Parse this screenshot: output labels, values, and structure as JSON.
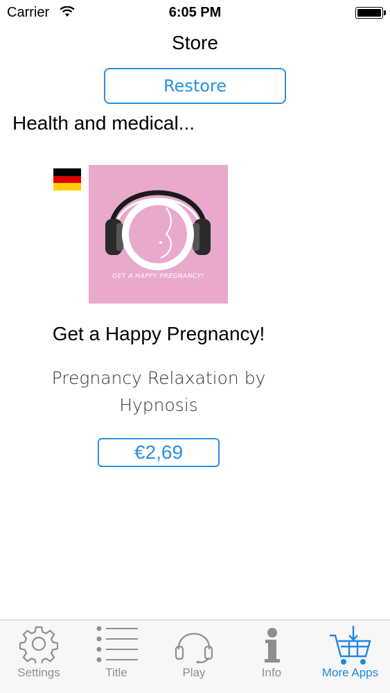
{
  "status_bar": {
    "carrier": "Carrier",
    "time": "6:05 PM",
    "battery_level": 1.0
  },
  "nav": {
    "title": "Store",
    "restore_label": "Restore"
  },
  "section": {
    "title": "Health and medical..."
  },
  "product": {
    "language_flag": "german-flag",
    "artwork_caption": "GET A HAPPY PREGNANCY!",
    "title": "Get a Happy Pregnancy!",
    "subtitle": "Pregnancy Relaxation by Hypnosis",
    "price": "€2,69"
  },
  "tab_bar": {
    "items": [
      {
        "label": "Settings",
        "icon": "gear-icon",
        "active": false
      },
      {
        "label": "Title",
        "icon": "list-icon",
        "active": false
      },
      {
        "label": "Play",
        "icon": "headphones-icon",
        "active": false
      },
      {
        "label": "Info",
        "icon": "info-icon",
        "active": false
      },
      {
        "label": "More Apps",
        "icon": "cart-icon",
        "active": true
      }
    ]
  },
  "colors": {
    "accent": "#2b8ee0",
    "artwork_bg": "#e9a9cd",
    "tab_inactive": "#8e8e8e",
    "tab_active": "#1e88e5"
  }
}
